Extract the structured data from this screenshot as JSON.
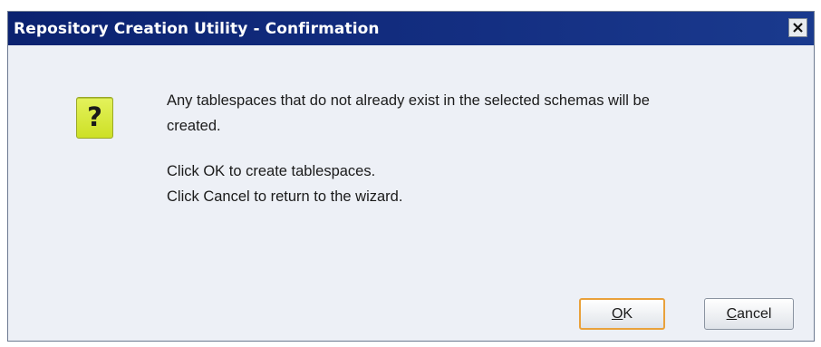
{
  "dialog": {
    "title": "Repository Creation Utility - Confirmation",
    "close_icon": "close-icon",
    "question_icon": "question-icon",
    "question_glyph": "?",
    "message": {
      "line1": "Any tablespaces that do not already exist in the selected schemas will be",
      "line2": "created.",
      "line3": "Click OK to create tablespaces.",
      "line4": "Click Cancel to return to the wizard."
    },
    "buttons": {
      "ok_mnemonic": "O",
      "ok_rest": "K",
      "cancel_mnemonic": "C",
      "cancel_rest": "ancel"
    },
    "colors": {
      "titlebar": "#0f2a78",
      "body": "#edf0f6",
      "icon": "#d8ea3e",
      "default_button_border": "#e9a13b"
    }
  }
}
